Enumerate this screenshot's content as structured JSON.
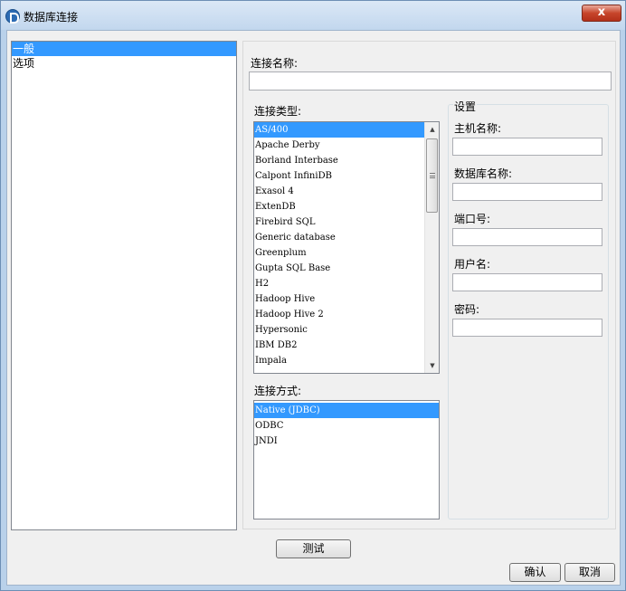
{
  "window": {
    "title": "数据库连接",
    "close_label": "x"
  },
  "nav": {
    "items": [
      {
        "label": "一般",
        "selected": true
      },
      {
        "label": "选项",
        "selected": false
      }
    ]
  },
  "form": {
    "connection_name_label": "连接名称:",
    "connection_name_value": "",
    "connection_type_label": "连接类型:",
    "connection_types": [
      "AS/400",
      "Apache Derby",
      "Borland Interbase",
      "Calpont InfiniDB",
      "Exasol 4",
      "ExtenDB",
      "Firebird SQL",
      "Generic database",
      "Greenplum",
      "Gupta SQL Base",
      "H2",
      "Hadoop Hive",
      "Hadoop Hive 2",
      "Hypersonic",
      "IBM DB2",
      "Impala"
    ],
    "selected_connection_type": "AS/400",
    "access_label": "连接方式:",
    "access_methods": [
      "Native (JDBC)",
      "ODBC",
      "JNDI"
    ],
    "selected_access_method": "Native (JDBC)"
  },
  "settings": {
    "title": "设置",
    "host_label": "主机名称:",
    "host_value": "",
    "db_name_label": "数据库名称:",
    "db_name_value": "",
    "port_label": "端口号:",
    "port_value": "",
    "user_label": "用户名:",
    "user_value": "",
    "password_label": "密码:",
    "password_value": ""
  },
  "buttons": {
    "test": "测试",
    "ok": "确认",
    "cancel": "取消"
  }
}
